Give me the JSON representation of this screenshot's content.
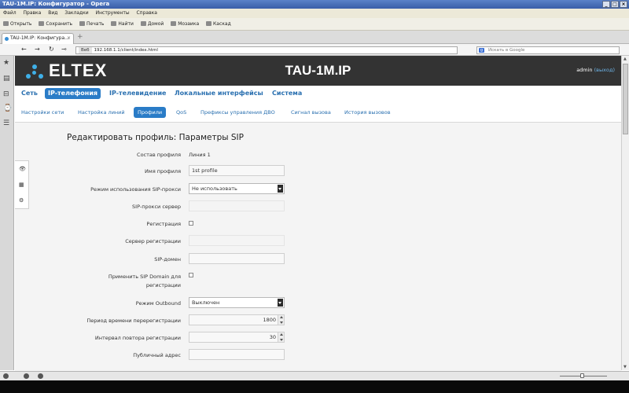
{
  "window": {
    "title": "TAU-1M.IP: Конфигуратор - Opera",
    "controls": [
      "_",
      "□",
      "×"
    ]
  },
  "menubar": [
    "Файл",
    "Правка",
    "Вид",
    "Закладки",
    "Инструменты",
    "Справка"
  ],
  "toolbar": [
    "Открыть",
    "Сохранить",
    "Печать",
    "Найти",
    "Домой",
    "Мозаика",
    "Каскад"
  ],
  "tab": {
    "label": "TAU-1M.IP: Конфигура...",
    "close": "×"
  },
  "newtab_label": "+",
  "address": {
    "back": "←",
    "forward": "→",
    "reload": "↻",
    "key": "⊸",
    "web_label": "Веб",
    "url": "192.168.1.1/client/index.html",
    "search_placeholder": "Искать в Google",
    "search_engine": "g"
  },
  "sidepanel": {
    "icons": [
      "★",
      "▤",
      "⊟",
      "⌚",
      "☰"
    ]
  },
  "header": {
    "logo": "ELTEX",
    "device_title": "TAU-1M.IP",
    "user": "admin",
    "logout": "(выход)",
    "logo_color": "#3fb0e8",
    "bg": "#333333"
  },
  "main_nav": [
    {
      "label": "Сеть"
    },
    {
      "label": "IP-телефония",
      "active": true
    },
    {
      "label": "IP-телевидение"
    },
    {
      "label": "Локальные интерфейсы"
    },
    {
      "label": "Система"
    }
  ],
  "sub_nav": [
    {
      "label": "Настройки сети"
    },
    {
      "label": "Настройка линий"
    },
    {
      "label": "Профили",
      "active": true
    },
    {
      "label": "QoS"
    },
    {
      "label": "Префиксы управления ДВО"
    },
    {
      "label": "Сигнал вызова"
    },
    {
      "label": "История вызовов"
    }
  ],
  "accent_color": "#2a7cc7",
  "form": {
    "title": "Редактировать профиль: Параметры SIP",
    "tool_icons": [
      "👁",
      "▦",
      "⚙"
    ],
    "fields": [
      {
        "label": "Состав профиля",
        "type": "text",
        "value": "Линия 1"
      },
      {
        "label": "Имя профиля",
        "type": "input",
        "value": "1st profile"
      },
      {
        "label": "Режим использования SIP-прокси",
        "type": "select",
        "value": "Не использовать"
      },
      {
        "label": "SIP-прокси сервер",
        "type": "input-disabled",
        "value": ""
      },
      {
        "label": "Регистрация",
        "type": "checkbox",
        "checked": false
      },
      {
        "label": "Сервер регистрации",
        "type": "input-disabled",
        "value": ""
      },
      {
        "label": "SIP-домен",
        "type": "input",
        "value": ""
      },
      {
        "label": "Применить SIP Domain для",
        "label2": "регистрации",
        "type": "checkbox",
        "checked": false
      },
      {
        "label": "Режим Outbound",
        "type": "select",
        "value": "Выключен"
      },
      {
        "label": "Период времени перерегистрации",
        "type": "number",
        "value": "1800"
      },
      {
        "label": "Интервал повтора регистрации",
        "type": "number",
        "value": "30"
      },
      {
        "label": "Публичный адрес",
        "type": "input",
        "value": ""
      }
    ]
  }
}
